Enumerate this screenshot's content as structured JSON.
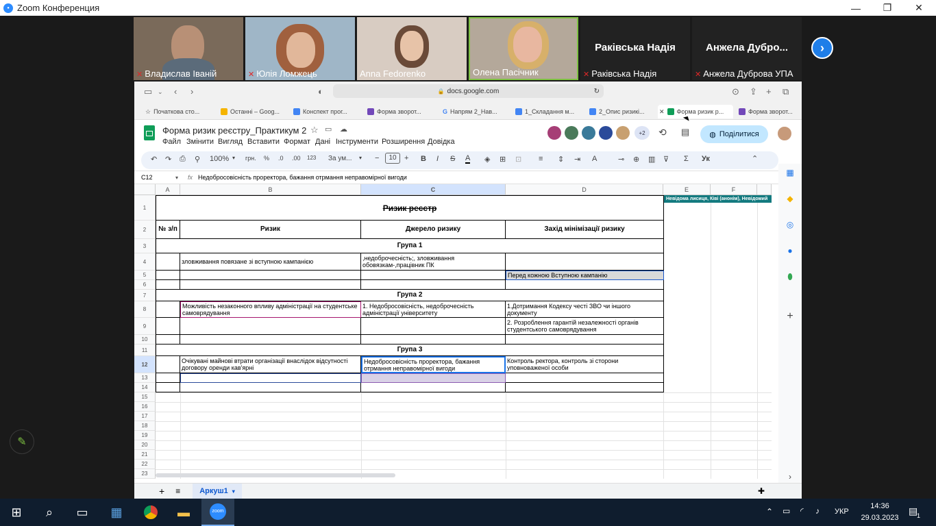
{
  "window": {
    "title": "Zoom Конференция",
    "minimize": "—",
    "restore": "❐",
    "close": "✕"
  },
  "participants": [
    {
      "name": "Владислав Іваній",
      "big": ""
    },
    {
      "name": "Юлія Ломжець",
      "big": ""
    },
    {
      "name": "Anna Fedorenko",
      "big": ""
    },
    {
      "name": "Олена Пасічник",
      "big": ""
    },
    {
      "name": "Раківська Надія",
      "big": "Раківська Надія"
    },
    {
      "name": "Анжела Дубрoва УПА",
      "big": "Анжела Дубро..."
    }
  ],
  "browser": {
    "url": "docs.google.com",
    "tabs": [
      "Початкова сто...",
      "Останні – Goog...",
      "Конспект прог...",
      "Форма зворот...",
      "Напрям 2_Нав...",
      "1_Складання м...",
      "2_Опис ризикі...",
      "Форма ризик р...",
      "Форма зворот..."
    ]
  },
  "doc": {
    "title": "Форма ризик реєстру_Практикум 2",
    "menus": [
      "Файл",
      "Змінити",
      "Вигляд",
      "Вставити",
      "Формат",
      "Дані",
      "Інструменти",
      "Розширення",
      "Довідка"
    ],
    "share": "Поділитися",
    "plus_count": "+2",
    "zoom": "100%",
    "currency": "грн.",
    "percent": "%",
    "dec_less": ".0",
    "dec_more": ".00",
    "num_fmt": "123",
    "font": "За ум...",
    "font_size": "10",
    "lang": "Ук"
  },
  "formula": {
    "cell_ref": "C12",
    "fx": "fx",
    "content": "Недобросовісність проректора, бажання отрмання неправомірної вигоди"
  },
  "columns": [
    "A",
    "B",
    "C",
    "D",
    "E",
    "F"
  ],
  "rows": [
    "1",
    "2",
    "3",
    "4",
    "5",
    "6",
    "7",
    "8",
    "9",
    "10",
    "11",
    "12",
    "13",
    "14",
    "15",
    "16",
    "17",
    "18",
    "19",
    "20",
    "21",
    "22",
    "23"
  ],
  "sheet": {
    "title": "Ризик реєстр",
    "hdr_num": "№ з/п",
    "hdr_risk": "Ризик",
    "hdr_source": "Джерело ризику",
    "hdr_measure": "Захід мінімізації ризику",
    "g1": "Група 1",
    "g2": "Група 2",
    "g3": "Група 3",
    "r4b": "зловживання повязане зі вступною кампанією",
    "r4c": ",недоброчесність;, зловживання обовязкам-,працівник ПК",
    "r5d": "Перед кожною Вступною кампанію",
    "r8b": "Можливість незаконного впливу адміністрації на студентське самоврядування",
    "r8c": "1. Недобросовісність, недоброчесність адміністрації університету",
    "r8d": "1.Дотримання Кодексу честі ЗВО чи іншого документу",
    "r9d": "2. Розроблення гарантій незалежності органів студентського самоврядування",
    "r12b": "Очікувані майнові втрати організації внаслідок відсутності договору оренди кав'ярні",
    "r12c": "Недобросовісність проректора, бажання отрмання неправомірної вигоди",
    "r12d": "Контроль ректора, контроль зі сторони уповноваженої особи",
    "viewers": "Невідома лисиця, Ківі (анонім), Невідомий"
  },
  "sheet_tab": "Аркуш1",
  "taskbar": {
    "lang": "УКР",
    "time": "14:36",
    "date": "29.03.2023",
    "notif": "1"
  }
}
